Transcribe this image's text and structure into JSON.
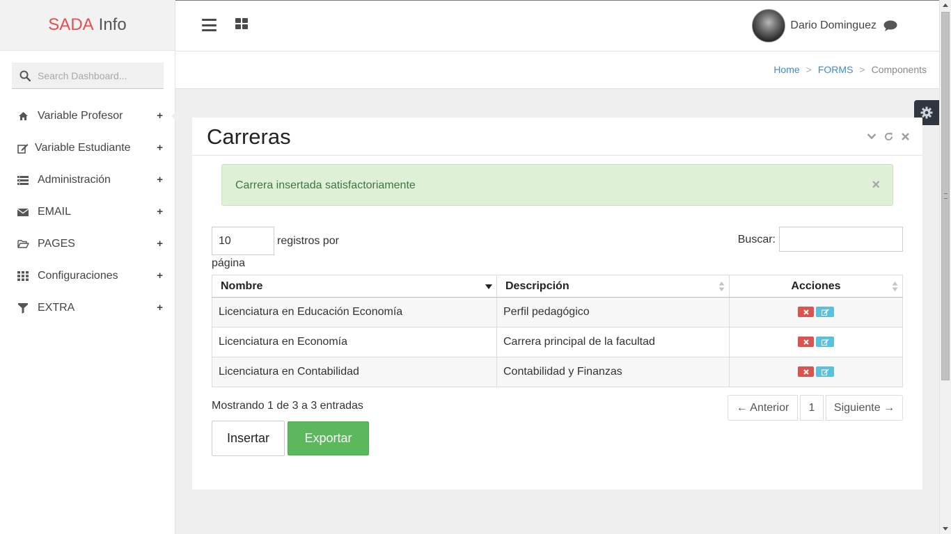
{
  "brand": {
    "part1": "SADA",
    "part2": "Info"
  },
  "sidebar": {
    "search_placeholder": "Search Dashboard...",
    "items": [
      {
        "label": "Variable Profesor",
        "icon": "home-icon"
      },
      {
        "label": "Variable Estudiante",
        "icon": "edit-icon"
      },
      {
        "label": "Administración",
        "icon": "list-icon"
      },
      {
        "label": "EMAIL",
        "icon": "envelope-icon"
      },
      {
        "label": "PAGES",
        "icon": "folder-open-icon"
      },
      {
        "label": "Configuraciones",
        "icon": "grid-icon"
      },
      {
        "label": "EXTRA",
        "icon": "filter-icon"
      }
    ],
    "expand_symbol": "+"
  },
  "header": {
    "user_name": "Dario Dominguez"
  },
  "breadcrumb": {
    "home": "Home",
    "forms": "FORMS",
    "current": "Components",
    "separator": ">"
  },
  "panel": {
    "title": "Carreras",
    "alert": {
      "text": "Carrera insertada satisfactoriamente",
      "close": "×"
    },
    "length": {
      "value": "10",
      "label_1": "registros por",
      "label_2": "página"
    },
    "search_label": "Buscar:",
    "table": {
      "headers": [
        "Nombre",
        "Descripción",
        "Acciones"
      ],
      "rows": [
        [
          "Licenciatura en Educación Economía",
          "Perfil pedagógico"
        ],
        [
          "Licenciatura en Economía",
          "Carrera principal de la facultad"
        ],
        [
          "Licenciatura en Contabilidad",
          "Contabilidad y Finanzas"
        ]
      ]
    },
    "info": "Mostrando 1 de 3 a 3 entradas",
    "pagination": {
      "prev": "← Anterior",
      "page": "1",
      "next": "Siguiente →"
    },
    "buttons": {
      "insert": "Insertar",
      "export": "Exportar"
    }
  },
  "colors": {
    "brand_red": "#e84c4c",
    "link_blue": "#3e8acc",
    "success_bg": "#dff0d8",
    "success_text": "#3c763d",
    "danger": "#d9534f",
    "info": "#5bc0de",
    "export_green": "#5cb85c"
  }
}
